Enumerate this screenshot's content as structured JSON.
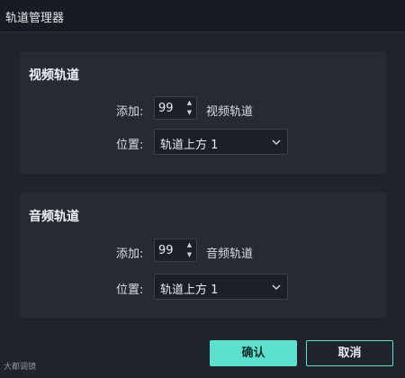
{
  "window": {
    "title": "轨道管理器"
  },
  "video": {
    "heading": "视频轨道",
    "add_label": "添加:",
    "add_value": "99",
    "add_suffix": "视频轨道",
    "position_label": "位置:",
    "position_value": "轨道上方 1"
  },
  "audio": {
    "heading": "音频轨道",
    "add_label": "添加:",
    "add_value": "99",
    "add_suffix": "音频轨道",
    "position_label": "位置:",
    "position_value": "轨道上方 1"
  },
  "buttons": {
    "ok": "确认",
    "cancel": "取消"
  },
  "watermark": "大都调镜",
  "icons": {
    "spin_up": "chevron-up-icon",
    "spin_down": "chevron-down-icon",
    "select": "chevron-down-icon"
  },
  "colors": {
    "accent": "#5ee0cf",
    "background": "#1f242c",
    "panel": "#252a33",
    "titlebar": "#181c22"
  }
}
